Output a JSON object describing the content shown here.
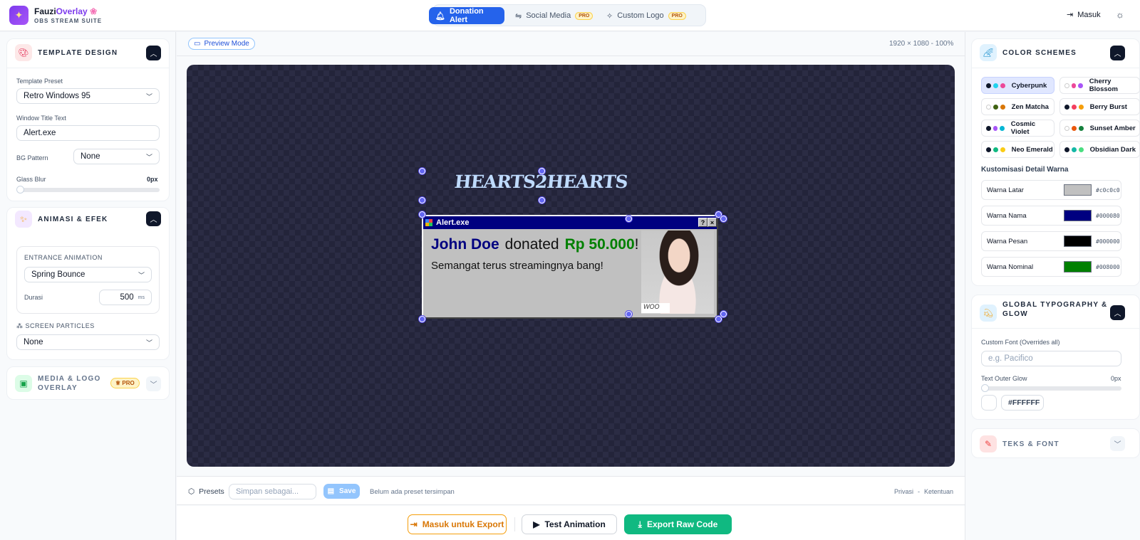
{
  "header": {
    "brand_part1": "Fauzi",
    "brand_part2": "Overlay",
    "brand_sub": "OBS STREAM SUITE",
    "tabs": [
      {
        "label": "Donation Alert",
        "icon": "bell-icon",
        "active": true
      },
      {
        "label": "Social Media",
        "icon": "share-icon",
        "badge": "PRO"
      },
      {
        "label": "Custom Logo",
        "icon": "sparkles-icon",
        "badge": "PRO"
      }
    ],
    "login_label": "Masuk"
  },
  "left": {
    "template": {
      "title": "TEMPLATE DESIGN",
      "preset_label": "Template Preset",
      "preset_value": "Retro Windows 95",
      "window_title_label": "Window Title Text",
      "window_title_value": "Alert.exe",
      "bg_pattern_label": "BG Pattern",
      "bg_pattern_value": "None",
      "glass_blur_label": "Glass Blur",
      "glass_blur_value": "0px"
    },
    "animation": {
      "title": "ANIMASI & EFEK",
      "entrance_label": "ENTRANCE ANIMATION",
      "entrance_value": "Spring Bounce",
      "duration_label": "Durasi",
      "duration_value": "500",
      "duration_unit": "ms",
      "particles_label": "SCREEN PARTICLES",
      "particles_value": "None"
    },
    "media": {
      "title_line1": "MEDIA & LOGO",
      "title_line2": "OVERLAY",
      "badge": "PRO"
    }
  },
  "center": {
    "preview_mode": "Preview Mode",
    "resolution": "1920 × 1080 - 100%",
    "logo_text": "HEARTS2HEARTS",
    "alert": {
      "window_title": "Alert.exe",
      "help_btn": "?",
      "close_btn": "×",
      "donor": "John Doe",
      "verb": "donated",
      "amount": "Rp 50.000",
      "exclaim": "!",
      "message": "Semangat terus streamingnya bang!",
      "photo_tag": "WOO"
    },
    "presets": {
      "label": "Presets",
      "placeholder": "Simpan sebagai...",
      "save_label": "Save",
      "empty_text": "Belum ada preset tersimpan",
      "privacy": "Privasi",
      "separator": "-",
      "terms": "Ketentuan"
    },
    "footer": {
      "login_export": "Masuk untuk Export",
      "test_animation": "Test Animation",
      "export_raw": "Export Raw Code"
    }
  },
  "right": {
    "color_schemes": {
      "title": "COLOR SCHEMES",
      "schemes": [
        {
          "name": "Cyberpunk",
          "dots": [
            "#0f172a",
            "#22d3ee",
            "#ec4899"
          ],
          "active": true
        },
        {
          "name": "Cherry Blossom",
          "dots": [
            "#ffffff",
            "#ec4899",
            "#a855f7"
          ]
        },
        {
          "name": "Zen Matcha",
          "dots": [
            "#ffffff",
            "#3f6212",
            "#d97706"
          ]
        },
        {
          "name": "Berry Burst",
          "dots": [
            "#0f172a",
            "#f43f5e",
            "#f59e0b"
          ]
        },
        {
          "name": "Cosmic Violet",
          "dots": [
            "#0f172a",
            "#a855f7",
            "#06b6d4"
          ]
        },
        {
          "name": "Sunset Amber",
          "dots": [
            "#ffffff",
            "#ea580c",
            "#15803d"
          ]
        },
        {
          "name": "Neo Emerald",
          "dots": [
            "#0f172a",
            "#10b981",
            "#facc15"
          ]
        },
        {
          "name": "Obsidian Dark",
          "dots": [
            "#0f172a",
            "#14b8a6",
            "#4ade80"
          ]
        }
      ],
      "custom_title": "Kustomisasi Detail Warna",
      "colors": [
        {
          "label": "Warna Latar",
          "hex": "#c0c0c0"
        },
        {
          "label": "Warna Nama",
          "hex": "#000080"
        },
        {
          "label": "Warna Pesan",
          "hex": "#000000"
        },
        {
          "label": "Warna Nominal",
          "hex": "#008000"
        }
      ]
    },
    "typography": {
      "title_line1": "GLOBAL TYPOGRAPHY &",
      "title_line2": "GLOW",
      "font_label": "Custom Font (Overrides all)",
      "font_placeholder": "e.g. Pacifico",
      "glow_label": "Text Outer Glow",
      "glow_value": "0px",
      "glow_hex": "#FFFFFF"
    },
    "text_font": {
      "title": "TEKS & FONT"
    }
  }
}
